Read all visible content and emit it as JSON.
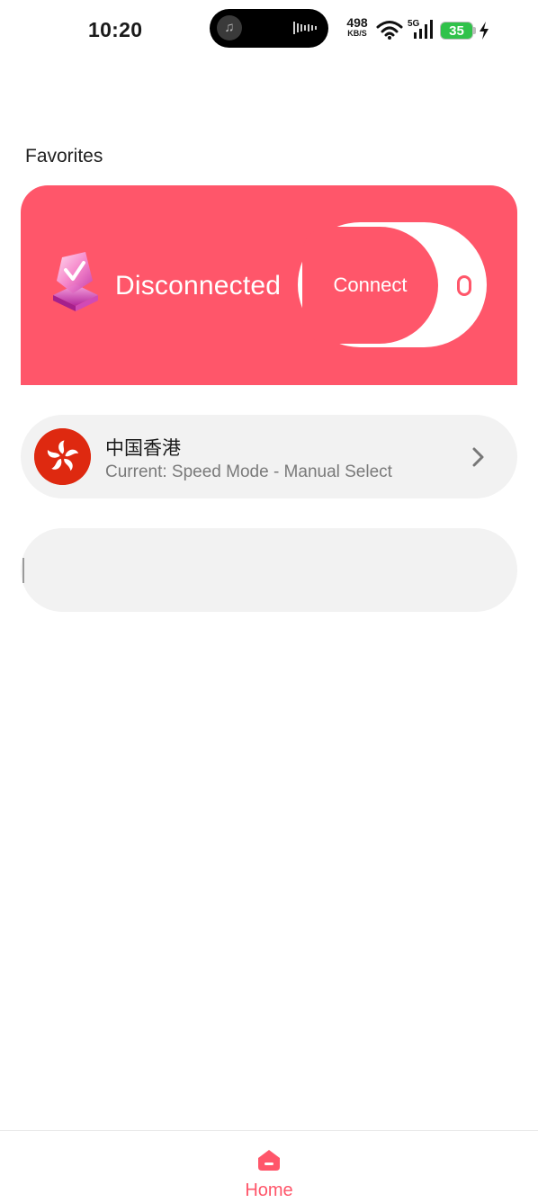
{
  "status_bar": {
    "time": "10:20",
    "net_speed_value": "498",
    "net_speed_unit": "KB/S",
    "network_type": "5G",
    "battery_level": "35"
  },
  "favorites": {
    "title": "Favorites"
  },
  "connection": {
    "status": "Disconnected",
    "connect_label": "Connect",
    "accent_color": "#ff566a",
    "status_icon": "gem-icon"
  },
  "server": {
    "name": "中国香港",
    "mode": "Current: Speed Mode - Manual Select",
    "flag_icon": "hong-kong-flag-icon"
  },
  "nav": {
    "home_label": "Home"
  }
}
